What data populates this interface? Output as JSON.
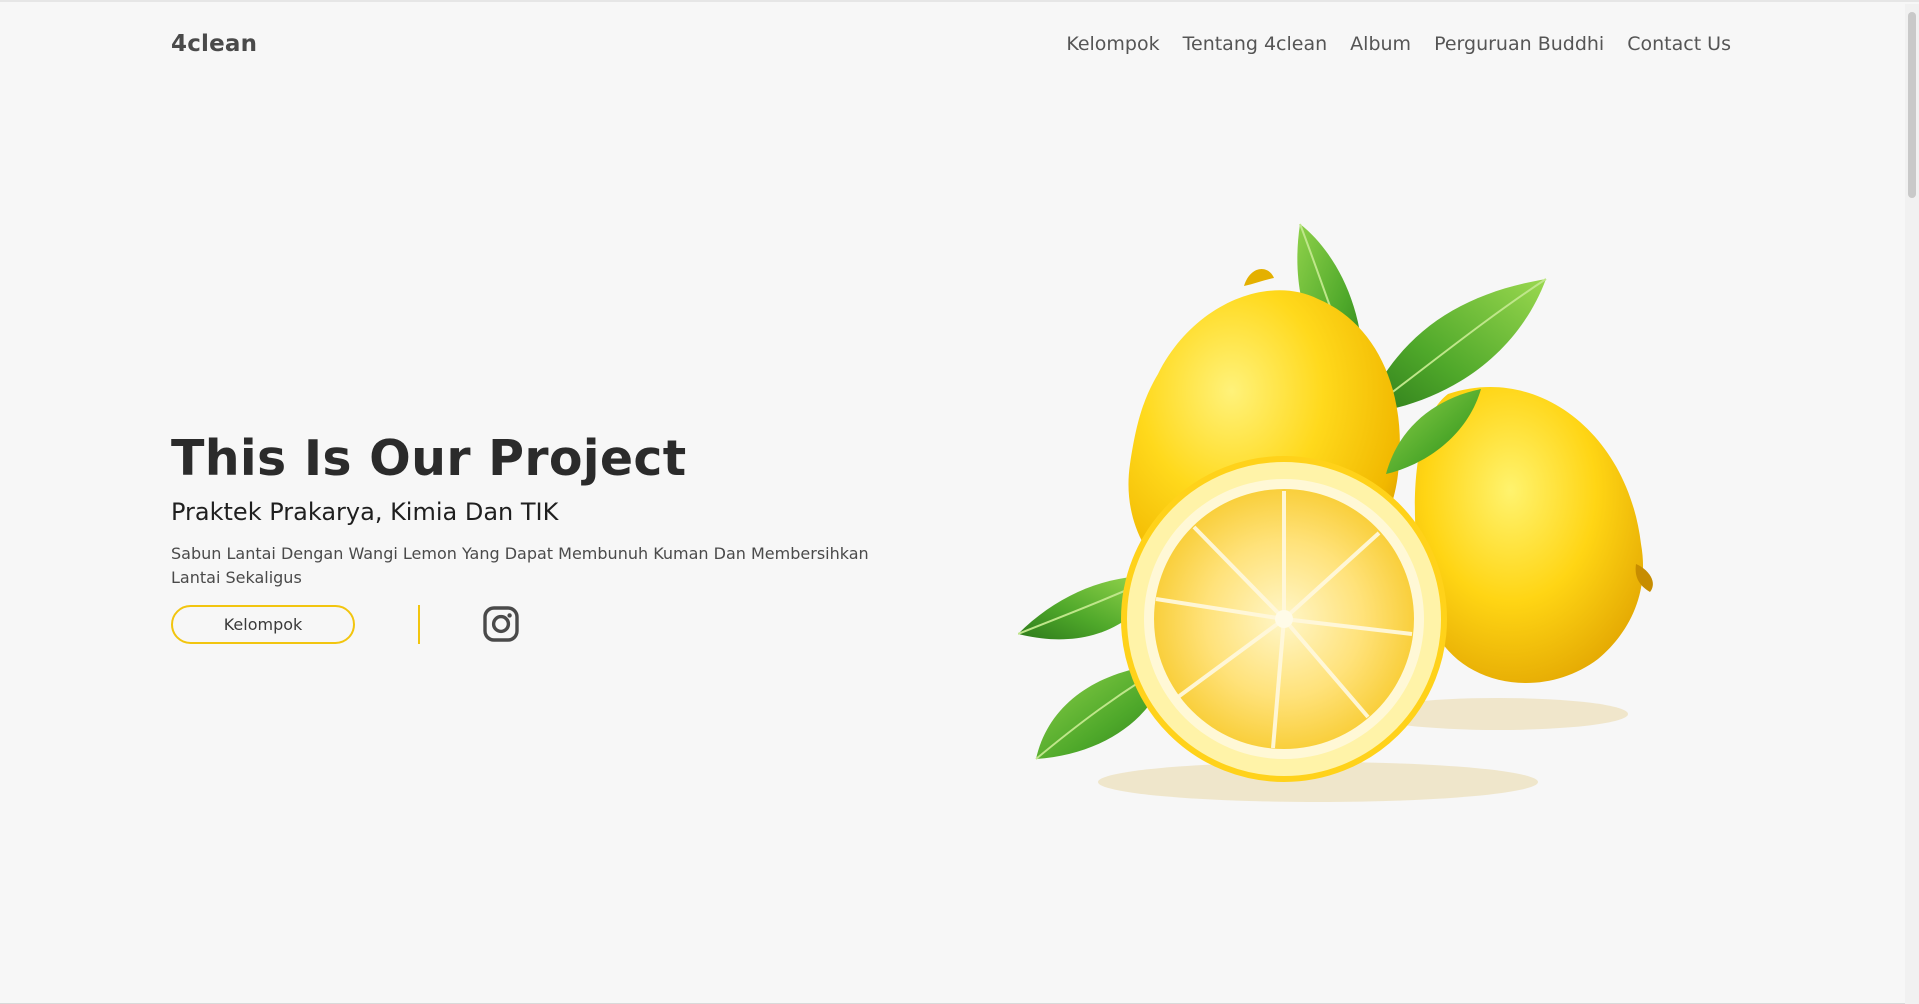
{
  "header": {
    "brand": "4clean",
    "nav": [
      {
        "label": "Kelompok"
      },
      {
        "label": "Tentang 4clean"
      },
      {
        "label": "Album"
      },
      {
        "label": "Perguruan Buddhi"
      },
      {
        "label": "Contact Us"
      }
    ]
  },
  "hero": {
    "title": "This Is Our Project",
    "subtitle": "Praktek Prakarya, Kimia Dan TIK",
    "description": "Sabun Lantai Dengan Wangi Lemon Yang Dapat Membunuh Kuman Dan Membersihkan Lantai Sekaligus",
    "button_label": "Kelompok",
    "social_icon": "instagram-icon",
    "image_subject": "lemon-image"
  },
  "colors": {
    "accent": "#f2c50f",
    "background": "#f7f7f7",
    "text_dark": "#2b2b2b",
    "text_muted": "#555555"
  }
}
